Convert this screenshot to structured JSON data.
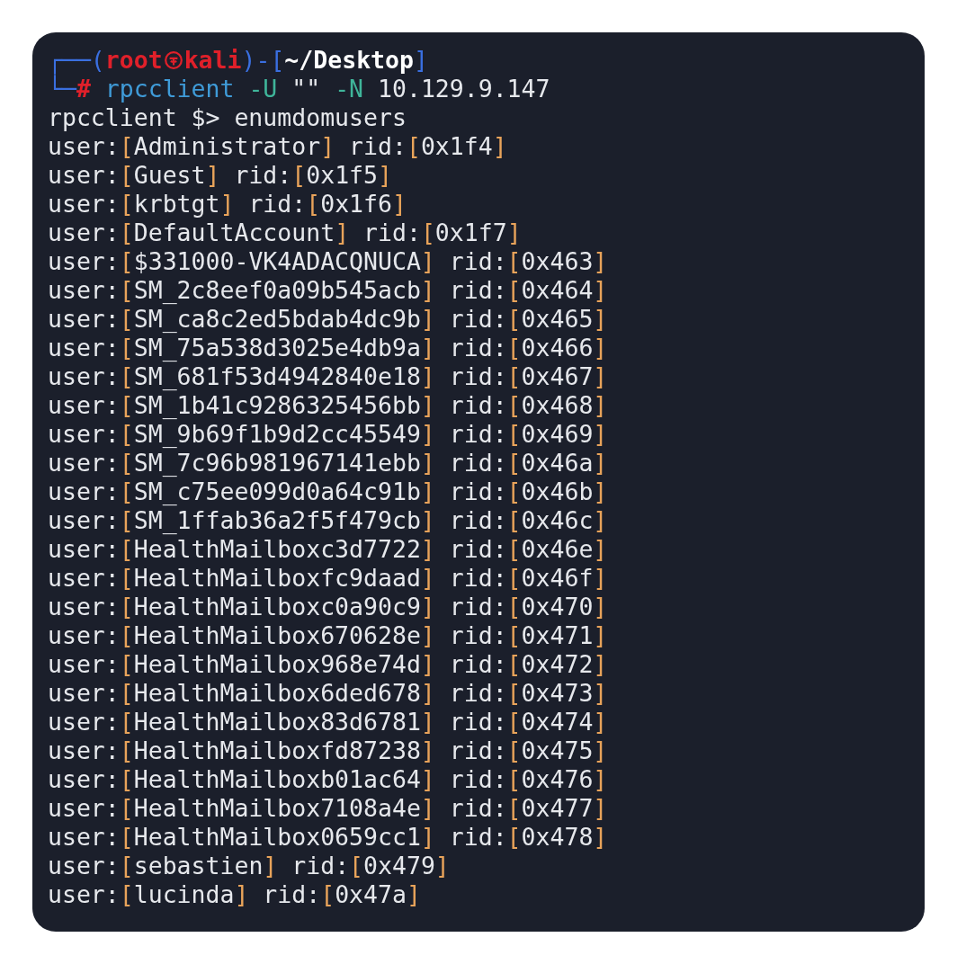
{
  "prompt": {
    "corner_top": "┌──(",
    "user": "root",
    "host": "kali",
    "between": ")-[",
    "path": "~/Desktop",
    "close": "]",
    "corner_bottom": "└─",
    "hash": "#",
    "command": [
      {
        "text": " rpcclient",
        "kind": "command"
      },
      {
        "text": " -U",
        "kind": "option"
      },
      {
        "text": " \"\"",
        "kind": "plain"
      },
      {
        "text": " -N",
        "kind": "option"
      },
      {
        "text": " 10.129.9.147",
        "kind": "plain"
      }
    ]
  },
  "output": [
    [
      {
        "text": "rpcclient $> enumdomusers",
        "kind": "plain"
      }
    ],
    [
      {
        "text": "user:",
        "kind": "plain"
      },
      {
        "text": "[",
        "kind": "bracket"
      },
      {
        "text": "Administrator",
        "kind": "plain"
      },
      {
        "text": "]",
        "kind": "bracket"
      },
      {
        "text": " rid:",
        "kind": "plain"
      },
      {
        "text": "[",
        "kind": "bracket"
      },
      {
        "text": "0x1f4",
        "kind": "plain"
      },
      {
        "text": "]",
        "kind": "bracket"
      }
    ],
    [
      {
        "text": "user:",
        "kind": "plain"
      },
      {
        "text": "[",
        "kind": "bracket"
      },
      {
        "text": "Guest",
        "kind": "plain"
      },
      {
        "text": "]",
        "kind": "bracket"
      },
      {
        "text": " rid:",
        "kind": "plain"
      },
      {
        "text": "[",
        "kind": "bracket"
      },
      {
        "text": "0x1f5",
        "kind": "plain"
      },
      {
        "text": "]",
        "kind": "bracket"
      }
    ],
    [
      {
        "text": "user:",
        "kind": "plain"
      },
      {
        "text": "[",
        "kind": "bracket"
      },
      {
        "text": "krbtgt",
        "kind": "plain"
      },
      {
        "text": "]",
        "kind": "bracket"
      },
      {
        "text": " rid:",
        "kind": "plain"
      },
      {
        "text": "[",
        "kind": "bracket"
      },
      {
        "text": "0x1f6",
        "kind": "plain"
      },
      {
        "text": "]",
        "kind": "bracket"
      }
    ],
    [
      {
        "text": "user:",
        "kind": "plain"
      },
      {
        "text": "[",
        "kind": "bracket"
      },
      {
        "text": "DefaultAccount",
        "kind": "plain"
      },
      {
        "text": "]",
        "kind": "bracket"
      },
      {
        "text": " rid:",
        "kind": "plain"
      },
      {
        "text": "[",
        "kind": "bracket"
      },
      {
        "text": "0x1f7",
        "kind": "plain"
      },
      {
        "text": "]",
        "kind": "bracket"
      }
    ],
    [
      {
        "text": "user:",
        "kind": "plain"
      },
      {
        "text": "[",
        "kind": "bracket"
      },
      {
        "text": "$331000-VK4ADACQNUCA",
        "kind": "plain"
      },
      {
        "text": "]",
        "kind": "bracket"
      },
      {
        "text": " rid:",
        "kind": "plain"
      },
      {
        "text": "[",
        "kind": "bracket"
      },
      {
        "text": "0x463",
        "kind": "plain"
      },
      {
        "text": "]",
        "kind": "bracket"
      }
    ],
    [
      {
        "text": "user:",
        "kind": "plain"
      },
      {
        "text": "[",
        "kind": "bracket"
      },
      {
        "text": "SM_2c8eef0a09b545acb",
        "kind": "plain"
      },
      {
        "text": "]",
        "kind": "bracket"
      },
      {
        "text": " rid:",
        "kind": "plain"
      },
      {
        "text": "[",
        "kind": "bracket"
      },
      {
        "text": "0x464",
        "kind": "plain"
      },
      {
        "text": "]",
        "kind": "bracket"
      }
    ],
    [
      {
        "text": "user:",
        "kind": "plain"
      },
      {
        "text": "[",
        "kind": "bracket"
      },
      {
        "text": "SM_ca8c2ed5bdab4dc9b",
        "kind": "plain"
      },
      {
        "text": "]",
        "kind": "bracket"
      },
      {
        "text": " rid:",
        "kind": "plain"
      },
      {
        "text": "[",
        "kind": "bracket"
      },
      {
        "text": "0x465",
        "kind": "plain"
      },
      {
        "text": "]",
        "kind": "bracket"
      }
    ],
    [
      {
        "text": "user:",
        "kind": "plain"
      },
      {
        "text": "[",
        "kind": "bracket"
      },
      {
        "text": "SM_75a538d3025e4db9a",
        "kind": "plain"
      },
      {
        "text": "]",
        "kind": "bracket"
      },
      {
        "text": " rid:",
        "kind": "plain"
      },
      {
        "text": "[",
        "kind": "bracket"
      },
      {
        "text": "0x466",
        "kind": "plain"
      },
      {
        "text": "]",
        "kind": "bracket"
      }
    ],
    [
      {
        "text": "user:",
        "kind": "plain"
      },
      {
        "text": "[",
        "kind": "bracket"
      },
      {
        "text": "SM_681f53d4942840e18",
        "kind": "plain"
      },
      {
        "text": "]",
        "kind": "bracket"
      },
      {
        "text": " rid:",
        "kind": "plain"
      },
      {
        "text": "[",
        "kind": "bracket"
      },
      {
        "text": "0x467",
        "kind": "plain"
      },
      {
        "text": "]",
        "kind": "bracket"
      }
    ],
    [
      {
        "text": "user:",
        "kind": "plain"
      },
      {
        "text": "[",
        "kind": "bracket"
      },
      {
        "text": "SM_1b41c9286325456bb",
        "kind": "plain"
      },
      {
        "text": "]",
        "kind": "bracket"
      },
      {
        "text": " rid:",
        "kind": "plain"
      },
      {
        "text": "[",
        "kind": "bracket"
      },
      {
        "text": "0x468",
        "kind": "plain"
      },
      {
        "text": "]",
        "kind": "bracket"
      }
    ],
    [
      {
        "text": "user:",
        "kind": "plain"
      },
      {
        "text": "[",
        "kind": "bracket"
      },
      {
        "text": "SM_9b69f1b9d2cc45549",
        "kind": "plain"
      },
      {
        "text": "]",
        "kind": "bracket"
      },
      {
        "text": " rid:",
        "kind": "plain"
      },
      {
        "text": "[",
        "kind": "bracket"
      },
      {
        "text": "0x469",
        "kind": "plain"
      },
      {
        "text": "]",
        "kind": "bracket"
      }
    ],
    [
      {
        "text": "user:",
        "kind": "plain"
      },
      {
        "text": "[",
        "kind": "bracket"
      },
      {
        "text": "SM_7c96b981967141ebb",
        "kind": "plain"
      },
      {
        "text": "]",
        "kind": "bracket"
      },
      {
        "text": " rid:",
        "kind": "plain"
      },
      {
        "text": "[",
        "kind": "bracket"
      },
      {
        "text": "0x46a",
        "kind": "plain"
      },
      {
        "text": "]",
        "kind": "bracket"
      }
    ],
    [
      {
        "text": "user:",
        "kind": "plain"
      },
      {
        "text": "[",
        "kind": "bracket"
      },
      {
        "text": "SM_c75ee099d0a64c91b",
        "kind": "plain"
      },
      {
        "text": "]",
        "kind": "bracket"
      },
      {
        "text": " rid:",
        "kind": "plain"
      },
      {
        "text": "[",
        "kind": "bracket"
      },
      {
        "text": "0x46b",
        "kind": "plain"
      },
      {
        "text": "]",
        "kind": "bracket"
      }
    ],
    [
      {
        "text": "user:",
        "kind": "plain"
      },
      {
        "text": "[",
        "kind": "bracket"
      },
      {
        "text": "SM_1ffab36a2f5f479cb",
        "kind": "plain"
      },
      {
        "text": "]",
        "kind": "bracket"
      },
      {
        "text": " rid:",
        "kind": "plain"
      },
      {
        "text": "[",
        "kind": "bracket"
      },
      {
        "text": "0x46c",
        "kind": "plain"
      },
      {
        "text": "]",
        "kind": "bracket"
      }
    ],
    [
      {
        "text": "user:",
        "kind": "plain"
      },
      {
        "text": "[",
        "kind": "bracket"
      },
      {
        "text": "HealthMailboxc3d7722",
        "kind": "plain"
      },
      {
        "text": "]",
        "kind": "bracket"
      },
      {
        "text": " rid:",
        "kind": "plain"
      },
      {
        "text": "[",
        "kind": "bracket"
      },
      {
        "text": "0x46e",
        "kind": "plain"
      },
      {
        "text": "]",
        "kind": "bracket"
      }
    ],
    [
      {
        "text": "user:",
        "kind": "plain"
      },
      {
        "text": "[",
        "kind": "bracket"
      },
      {
        "text": "HealthMailboxfc9daad",
        "kind": "plain"
      },
      {
        "text": "]",
        "kind": "bracket"
      },
      {
        "text": " rid:",
        "kind": "plain"
      },
      {
        "text": "[",
        "kind": "bracket"
      },
      {
        "text": "0x46f",
        "kind": "plain"
      },
      {
        "text": "]",
        "kind": "bracket"
      }
    ],
    [
      {
        "text": "user:",
        "kind": "plain"
      },
      {
        "text": "[",
        "kind": "bracket"
      },
      {
        "text": "HealthMailboxc0a90c9",
        "kind": "plain"
      },
      {
        "text": "]",
        "kind": "bracket"
      },
      {
        "text": " rid:",
        "kind": "plain"
      },
      {
        "text": "[",
        "kind": "bracket"
      },
      {
        "text": "0x470",
        "kind": "plain"
      },
      {
        "text": "]",
        "kind": "bracket"
      }
    ],
    [
      {
        "text": "user:",
        "kind": "plain"
      },
      {
        "text": "[",
        "kind": "bracket"
      },
      {
        "text": "HealthMailbox670628e",
        "kind": "plain"
      },
      {
        "text": "]",
        "kind": "bracket"
      },
      {
        "text": " rid:",
        "kind": "plain"
      },
      {
        "text": "[",
        "kind": "bracket"
      },
      {
        "text": "0x471",
        "kind": "plain"
      },
      {
        "text": "]",
        "kind": "bracket"
      }
    ],
    [
      {
        "text": "user:",
        "kind": "plain"
      },
      {
        "text": "[",
        "kind": "bracket"
      },
      {
        "text": "HealthMailbox968e74d",
        "kind": "plain"
      },
      {
        "text": "]",
        "kind": "bracket"
      },
      {
        "text": " rid:",
        "kind": "plain"
      },
      {
        "text": "[",
        "kind": "bracket"
      },
      {
        "text": "0x472",
        "kind": "plain"
      },
      {
        "text": "]",
        "kind": "bracket"
      }
    ],
    [
      {
        "text": "user:",
        "kind": "plain"
      },
      {
        "text": "[",
        "kind": "bracket"
      },
      {
        "text": "HealthMailbox6ded678",
        "kind": "plain"
      },
      {
        "text": "]",
        "kind": "bracket"
      },
      {
        "text": " rid:",
        "kind": "plain"
      },
      {
        "text": "[",
        "kind": "bracket"
      },
      {
        "text": "0x473",
        "kind": "plain"
      },
      {
        "text": "]",
        "kind": "bracket"
      }
    ],
    [
      {
        "text": "user:",
        "kind": "plain"
      },
      {
        "text": "[",
        "kind": "bracket"
      },
      {
        "text": "HealthMailbox83d6781",
        "kind": "plain"
      },
      {
        "text": "]",
        "kind": "bracket"
      },
      {
        "text": " rid:",
        "kind": "plain"
      },
      {
        "text": "[",
        "kind": "bracket"
      },
      {
        "text": "0x474",
        "kind": "plain"
      },
      {
        "text": "]",
        "kind": "bracket"
      }
    ],
    [
      {
        "text": "user:",
        "kind": "plain"
      },
      {
        "text": "[",
        "kind": "bracket"
      },
      {
        "text": "HealthMailboxfd87238",
        "kind": "plain"
      },
      {
        "text": "]",
        "kind": "bracket"
      },
      {
        "text": " rid:",
        "kind": "plain"
      },
      {
        "text": "[",
        "kind": "bracket"
      },
      {
        "text": "0x475",
        "kind": "plain"
      },
      {
        "text": "]",
        "kind": "bracket"
      }
    ],
    [
      {
        "text": "user:",
        "kind": "plain"
      },
      {
        "text": "[",
        "kind": "bracket"
      },
      {
        "text": "HealthMailboxb01ac64",
        "kind": "plain"
      },
      {
        "text": "]",
        "kind": "bracket"
      },
      {
        "text": " rid:",
        "kind": "plain"
      },
      {
        "text": "[",
        "kind": "bracket"
      },
      {
        "text": "0x476",
        "kind": "plain"
      },
      {
        "text": "]",
        "kind": "bracket"
      }
    ],
    [
      {
        "text": "user:",
        "kind": "plain"
      },
      {
        "text": "[",
        "kind": "bracket"
      },
      {
        "text": "HealthMailbox7108a4e",
        "kind": "plain"
      },
      {
        "text": "]",
        "kind": "bracket"
      },
      {
        "text": " rid:",
        "kind": "plain"
      },
      {
        "text": "[",
        "kind": "bracket"
      },
      {
        "text": "0x477",
        "kind": "plain"
      },
      {
        "text": "]",
        "kind": "bracket"
      }
    ],
    [
      {
        "text": "user:",
        "kind": "plain"
      },
      {
        "text": "[",
        "kind": "bracket"
      },
      {
        "text": "HealthMailbox0659cc1",
        "kind": "plain"
      },
      {
        "text": "]",
        "kind": "bracket"
      },
      {
        "text": " rid:",
        "kind": "plain"
      },
      {
        "text": "[",
        "kind": "bracket"
      },
      {
        "text": "0x478",
        "kind": "plain"
      },
      {
        "text": "]",
        "kind": "bracket"
      }
    ],
    [
      {
        "text": "user:",
        "kind": "plain"
      },
      {
        "text": "[",
        "kind": "bracket"
      },
      {
        "text": "sebastien",
        "kind": "plain"
      },
      {
        "text": "]",
        "kind": "bracket"
      },
      {
        "text": " rid:",
        "kind": "plain"
      },
      {
        "text": "[",
        "kind": "bracket"
      },
      {
        "text": "0x479",
        "kind": "plain"
      },
      {
        "text": "]",
        "kind": "bracket"
      }
    ],
    [
      {
        "text": "user:",
        "kind": "plain"
      },
      {
        "text": "[",
        "kind": "bracket"
      },
      {
        "text": "lucinda",
        "kind": "plain"
      },
      {
        "text": "]",
        "kind": "bracket"
      },
      {
        "text": " rid:",
        "kind": "plain"
      },
      {
        "text": "[",
        "kind": "bracket"
      },
      {
        "text": "0x47a",
        "kind": "plain"
      },
      {
        "text": "]",
        "kind": "bracket"
      }
    ]
  ]
}
